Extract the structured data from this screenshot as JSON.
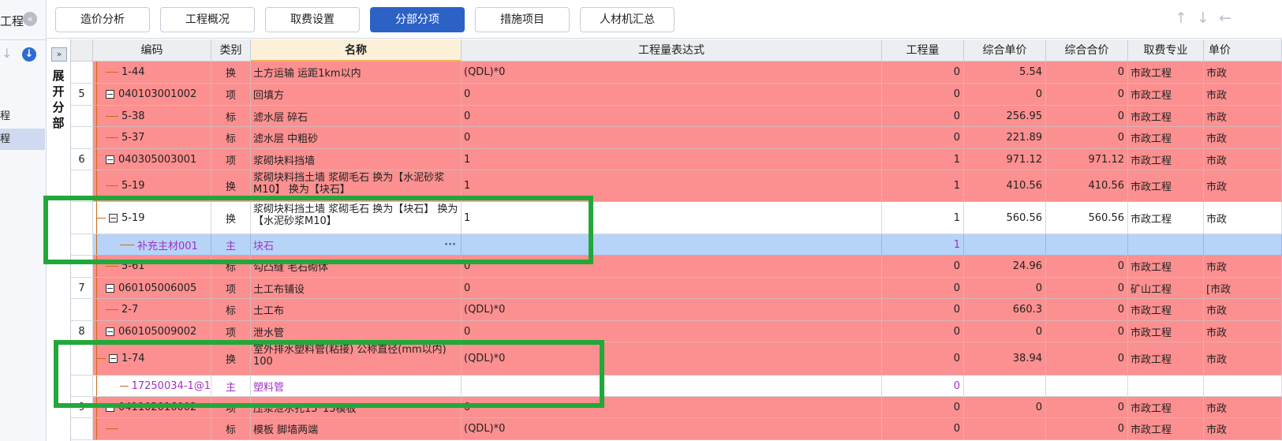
{
  "left_panel": {
    "title": "工程",
    "items": [
      "程",
      "程"
    ]
  },
  "toolbar": {
    "tabs": [
      {
        "label": "造价分析",
        "active": false
      },
      {
        "label": "工程概况",
        "active": false
      },
      {
        "label": "取费设置",
        "active": false
      },
      {
        "label": "分部分项",
        "active": true
      },
      {
        "label": "措施项目",
        "active": false
      },
      {
        "label": "人材机汇总",
        "active": false
      }
    ],
    "arrows": [
      "↑",
      "↓",
      "←"
    ]
  },
  "expand": {
    "button": "»",
    "label": "展开分部"
  },
  "columns": [
    "编码",
    "类别",
    "名称",
    "工程量表达式",
    "工程量",
    "综合单价",
    "综合合价",
    "取费专业",
    "单价"
  ],
  "rows": [
    {
      "style": "pink",
      "rn": "",
      "code": "1-44",
      "kind": "leaf",
      "type": "换",
      "name": "土方运输 运距1km以内",
      "expr": "(QDL)*0",
      "qty": "0",
      "unit_price": "5.54",
      "total": "0",
      "fee": "市政工程",
      "price": "市政"
    },
    {
      "style": "pink",
      "rn": "5",
      "code": "040103001002",
      "kind": "group",
      "type": "项",
      "name": "回填方",
      "expr": "0",
      "qty": "0",
      "unit_price": "0",
      "total": "0",
      "fee": "市政工程",
      "price": "市政"
    },
    {
      "style": "pink",
      "rn": "",
      "code": "5-38",
      "kind": "leaf",
      "type": "标",
      "name": "滤水层 碎石",
      "expr": "0",
      "qty": "0",
      "unit_price": "256.95",
      "total": "0",
      "fee": "市政工程",
      "price": "市政"
    },
    {
      "style": "pink",
      "rn": "",
      "code": "5-37",
      "kind": "leaf",
      "type": "标",
      "name": "滤水层 中粗砂",
      "expr": "0",
      "qty": "0",
      "unit_price": "221.89",
      "total": "0",
      "fee": "市政工程",
      "price": "市政"
    },
    {
      "style": "pink",
      "rn": "6",
      "code": "040305003001",
      "kind": "group",
      "type": "项",
      "name": "浆砌块料挡墙",
      "expr": "1",
      "qty": "1",
      "unit_price": "971.12",
      "total": "971.12",
      "fee": "市政工程",
      "price": "市政"
    },
    {
      "style": "pink",
      "rn": "",
      "code": "5-19",
      "kind": "leaf",
      "type": "换",
      "name": "浆砌块料挡土墙 浆砌毛石  换为【水泥砂浆M10】  换为【块石】",
      "expr": "1",
      "qty": "1",
      "unit_price": "410.56",
      "total": "410.56",
      "fee": "市政工程",
      "price": "市政"
    },
    {
      "style": "white",
      "rn": "",
      "code": "5-19",
      "kind": "subgroup",
      "type": "换",
      "name": "浆砌块料挡土墙 浆砌毛石  换为【块石】  换为【水泥砂浆M10】",
      "expr": "1",
      "qty": "1",
      "unit_price": "560.56",
      "total": "560.56",
      "fee": "市政工程",
      "price": "市政"
    },
    {
      "style": "blue",
      "rn": "",
      "code": "补充主材001",
      "kind": "material",
      "type": "主",
      "name": "块石",
      "expr": "",
      "qty": "1",
      "unit_price": "",
      "total": "",
      "fee": "",
      "price": ""
    },
    {
      "style": "pink",
      "rn": "",
      "code": "5-61",
      "kind": "leaf",
      "type": "标",
      "name": "勾凸缝 毛石砌体",
      "expr": "0",
      "qty": "0",
      "unit_price": "24.96",
      "total": "0",
      "fee": "市政工程",
      "price": "市政"
    },
    {
      "style": "pink",
      "rn": "7",
      "code": "060105006005",
      "kind": "group",
      "type": "项",
      "name": "土工布铺设",
      "expr": "0",
      "qty": "0",
      "unit_price": "0",
      "total": "0",
      "fee": "矿山工程",
      "price": "[市政"
    },
    {
      "style": "pink",
      "rn": "",
      "code": "2-7",
      "kind": "leaf",
      "type": "标",
      "name": "土工布",
      "expr": "(QDL)*0",
      "qty": "0",
      "unit_price": "660.3",
      "total": "0",
      "fee": "市政工程",
      "price": "市政"
    },
    {
      "style": "pink",
      "rn": "8",
      "code": "060105009002",
      "kind": "group",
      "type": "项",
      "name": "泄水管",
      "expr": "0",
      "qty": "0",
      "unit_price": "0",
      "total": "0",
      "fee": "市政工程",
      "price": "市政"
    },
    {
      "style": "pink",
      "rn": "",
      "code": "1-74",
      "kind": "subgroup",
      "type": "换",
      "name": "室外排水塑料管(粘接) 公称直径(mm以内) 100",
      "expr": "(QDL)*0",
      "qty": "0",
      "unit_price": "38.94",
      "total": "0",
      "fee": "市政工程",
      "price": "市政"
    },
    {
      "style": "white",
      "rn": "",
      "code": "17250034-1@1",
      "kind": "material",
      "type": "主",
      "name": "塑料管",
      "expr": "",
      "qty": "0",
      "unit_price": "",
      "total": "",
      "fee": "",
      "price": ""
    },
    {
      "style": "pink",
      "rn": "9",
      "code": "041102016002",
      "kind": "group",
      "type": "项",
      "name": "压浆泄水孔15*15模板",
      "expr": "0",
      "qty": "0",
      "unit_price": "0",
      "total": "0",
      "fee": "市政工程",
      "price": "市政"
    },
    {
      "style": "pink",
      "rn": "",
      "code": "",
      "kind": "leaf",
      "type": "标",
      "name": "模板 脚墙两端",
      "expr": "(QDL)*0",
      "qty": "0",
      "unit_price": "",
      "total": "0",
      "fee": "市政工程",
      "price": "市政"
    }
  ]
}
